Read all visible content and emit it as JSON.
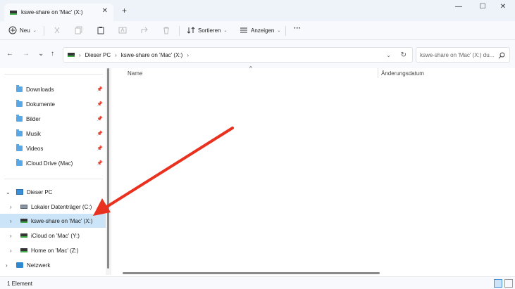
{
  "window": {
    "tab_title": "kswe-share on 'Mac' (X:)",
    "tab_close": "✕",
    "new_tab": "+",
    "minimize": "—",
    "maximize": "☐",
    "close": "✕"
  },
  "toolbar": {
    "new_label": "Neu",
    "sort_label": "Sortieren",
    "view_label": "Anzeigen",
    "more_label": "···"
  },
  "navigation": {
    "back": "←",
    "forward": "→",
    "recent": "⌄",
    "up": "↑",
    "breadcrumb": [
      "Dieser PC",
      "kswe-share on 'Mac' (X:)"
    ],
    "search_placeholder": "kswe-share on 'Mac' (X:) du..."
  },
  "sidebar": {
    "quick_access": [
      {
        "label": "Downloads",
        "icon": "downloads-folder-icon"
      },
      {
        "label": "Dokumente",
        "icon": "documents-folder-icon"
      },
      {
        "label": "Bilder",
        "icon": "pictures-folder-icon"
      },
      {
        "label": "Musik",
        "icon": "music-folder-icon"
      },
      {
        "label": "Videos",
        "icon": "videos-folder-icon"
      },
      {
        "label": "iCloud Drive (Mac)",
        "icon": "folder-icon"
      }
    ],
    "this_pc": "Dieser PC",
    "drives": [
      {
        "label": "Lokaler Datenträger (C:)",
        "icon": "hard-drive-icon",
        "selected": false
      },
      {
        "label": "kswe-share on 'Mac' (X:)",
        "icon": "network-drive-icon",
        "selected": true
      },
      {
        "label": "iCloud on 'Mac' (Y:)",
        "icon": "network-drive-icon",
        "selected": false
      },
      {
        "label": "Home on 'Mac' (Z:)",
        "icon": "network-drive-icon",
        "selected": false
      }
    ],
    "network": "Netzwerk"
  },
  "content": {
    "columns": [
      "Name",
      "Änderungsdatum"
    ]
  },
  "status": {
    "item_count": "1 Element"
  },
  "colors": {
    "accent": "#cce4f7",
    "annotation_arrow": "#e8311f"
  }
}
